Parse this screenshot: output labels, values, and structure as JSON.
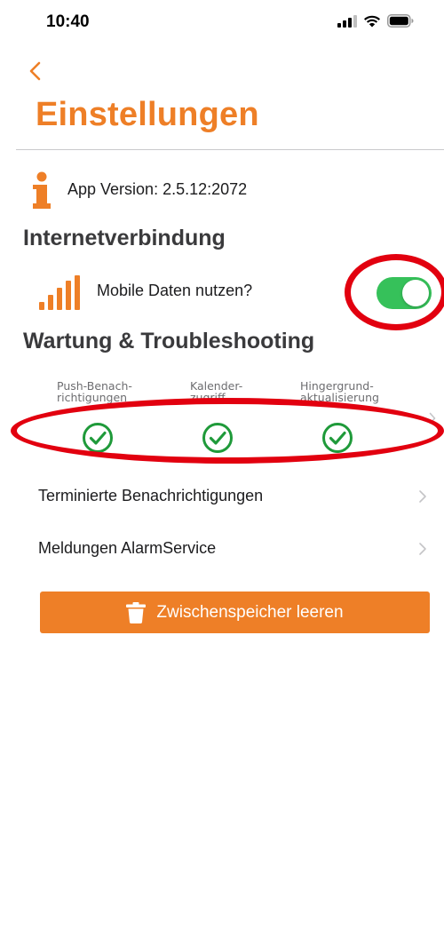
{
  "status_bar": {
    "time": "10:40",
    "icons": [
      "cellular-signal-icon",
      "wifi-icon",
      "battery-icon"
    ]
  },
  "nav": {
    "back_icon": "chevron-left-icon"
  },
  "page": {
    "title": "Einstellungen"
  },
  "app_info": {
    "icon": "info-icon",
    "version_text": "App Version: 2.5.12:2072"
  },
  "internet_section": {
    "header": "Internetverbindung",
    "mobile_data": {
      "icon": "signal-bars-icon",
      "label": "Mobile Daten nutzen?",
      "enabled": true
    }
  },
  "maintenance_section": {
    "header": "Wartung & Troubleshooting",
    "permissions": [
      {
        "label_line1": "Push-Benach-",
        "label_line2": "richtigungen",
        "status": "granted",
        "icon": "check-circle-icon"
      },
      {
        "label_line1": "Kalender-",
        "label_line2": "zugriff",
        "status": "granted",
        "icon": "check-circle-icon"
      },
      {
        "label_line1": "Hingergrund-",
        "label_line2": "aktualisierung",
        "status": "granted",
        "icon": "check-circle-icon"
      }
    ],
    "items": [
      {
        "label": "Terminierte Benachrichtigungen"
      },
      {
        "label": "Meldungen AlarmService"
      }
    ]
  },
  "clear_cache_button": {
    "icon": "trash-icon",
    "label": "Zwischenspeicher leeren"
  },
  "colors": {
    "accent": "#ee7f27",
    "toggle_on": "#36c15a",
    "check": "#1f9a3a",
    "annotation": "#e2000f"
  }
}
